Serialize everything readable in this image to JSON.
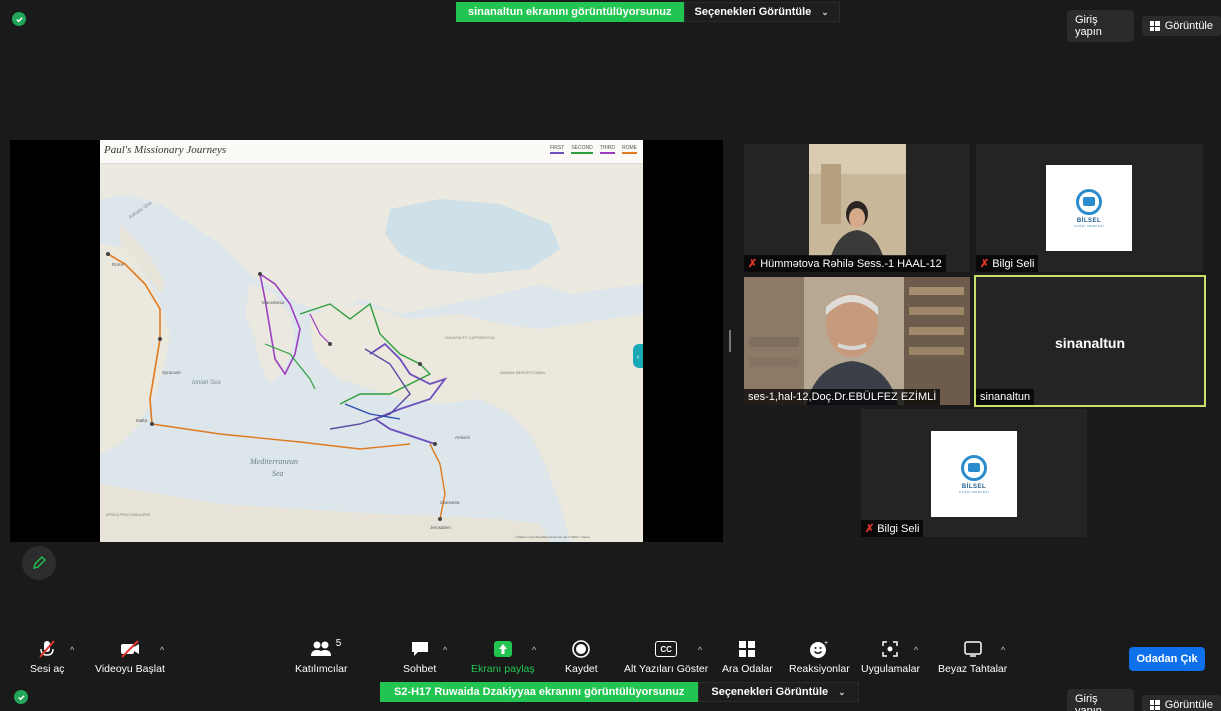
{
  "top": {
    "share_banner": "sinanaltun ekranını görüntülüyorsunuz",
    "view_options": "Seçenekleri Görüntüle",
    "sign_in": "Giriş yapın",
    "view": "Görüntüle"
  },
  "slide": {
    "title": "Paul's Missionary Journeys",
    "legend": [
      {
        "label": "FIRST",
        "color": "#6b4fbb"
      },
      {
        "label": "SECOND",
        "color": "#2e9e3e"
      },
      {
        "label": "THIRD",
        "color": "#9b3fc0"
      },
      {
        "label": "ROME",
        "color": "#e07a1f"
      }
    ],
    "map_labels": {
      "adriatic": "Adriatic Sea",
      "ionian": "Ionian Sea",
      "mediterranean": "Mediterranean",
      "sea": "Sea",
      "arabia": "ARABIA MESOPOTAMIA",
      "galatia": "GALATIA ET CAPPADOCIA",
      "macedonia": "Macedonia",
      "rome": "Rome",
      "syracuse": "Syracuse",
      "malta": "Malta",
      "caesarea": "Caesarea",
      "jerusalem": "Jerusalem",
      "antioch": "Antioch",
      "africa": "AFRICA PROCONSULARIS",
      "credits": "© Mapbox © OpenStreetMap  Improve this map  © AWMC  © Stamen"
    }
  },
  "participants": {
    "hummatova": "Hümmətova Rəhilə Sess.-1  HAAL-12",
    "bilgi1": "Bilgi Seli",
    "ebulfez": "ses-1,hal-12,Doç.Dr.EBÜLFEZ EZİMLİ",
    "sinan_center": "sinanaltun",
    "sinan_tag": "sinanaltun",
    "bilgi2": "Bilgi Seli",
    "logo_text": "BİLSEL",
    "logo_sub": "ÇAĞRI MERKEZİ"
  },
  "toolbar": {
    "mute": "Sesi aç",
    "video": "Videoyu Başlat",
    "participants": "Katılımcılar",
    "participants_count": "5",
    "chat": "Sohbet",
    "share": "Ekranı paylaş",
    "record": "Kaydet",
    "captions": "Alt Yazıları Göster",
    "breakout": "Ara Odalar",
    "reactions": "Reaksiyonlar",
    "apps": "Uygulamalar",
    "whiteboard": "Beyaz Tahtalar",
    "leave": "Odadan Çık",
    "cc_icon": "CC"
  },
  "bottom": {
    "share_banner": "S2-H17 Ruwaida Dzakiyyaa ekranını görüntülüyorsunuz",
    "view_options": "Seçenekleri Görüntüle",
    "sign_in": "Giriş yapın",
    "view": "Görüntüle"
  },
  "colors": {
    "background": "#1a1a1a",
    "share_green": "#23c552",
    "leave_blue": "#0e71eb",
    "active_speaker": "#c8e06a"
  }
}
